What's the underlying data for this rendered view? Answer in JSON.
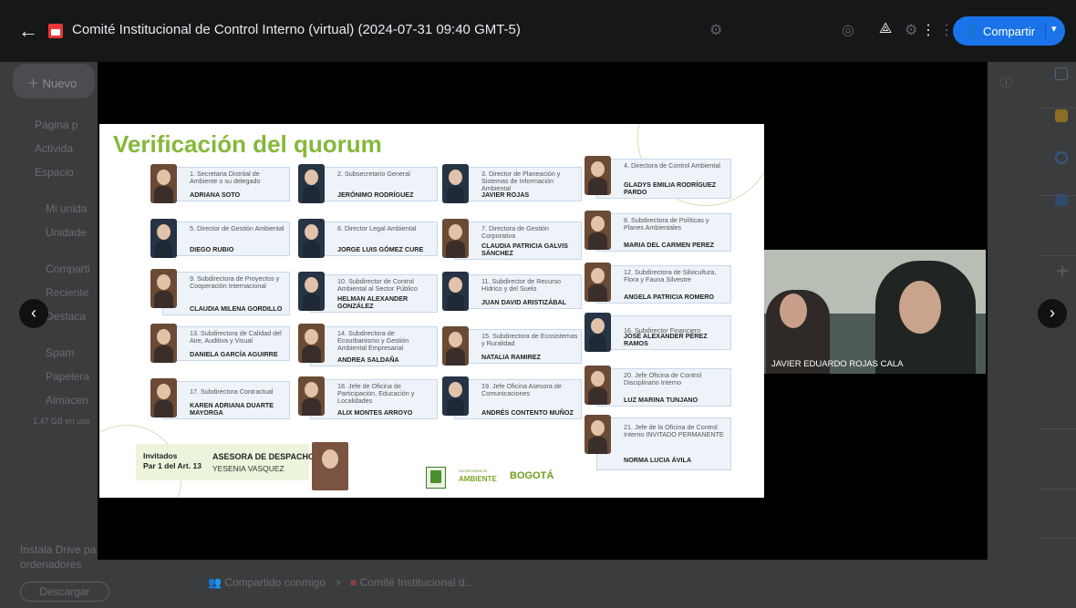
{
  "header": {
    "title": "Comité Institucional de Control Interno (virtual) (2024-07-31 09:40 GMT-5)",
    "share_label": "Compartir",
    "back_glyph": "←"
  },
  "drive": {
    "new_label": "Nuevo",
    "nav": [
      "Página p",
      "Activida",
      "Espacio",
      "Mi unida",
      "Unidade",
      "Comparti",
      "Reciente",
      "Destaca",
      "Spam",
      "Papelera",
      "Almacen"
    ],
    "storage": "1,47 GB en uso",
    "promo_line1": "Instala Drive pa",
    "promo_line2": "ordenadores",
    "download_label": "Descargar",
    "crumb_root": "Compartido conmigo",
    "crumb_sep": ">",
    "crumb_folder": "Comité Institucional d..."
  },
  "slide": {
    "title": "Verificación del quorum",
    "members": [
      {
        "role": "1. Secretaria Distrital de Ambiente o su delegado",
        "name": "ADRIANA SOTO"
      },
      {
        "role": "2. Subsecretario General",
        "name": "JERÓNIMO RODRÍGUEZ"
      },
      {
        "role": "3. Director de Planeación y Sistemas de Información Ambiental",
        "name": "JAVIER ROJAS"
      },
      {
        "role": "4. Directora de Control Ambiental",
        "name": "GLADYS EMILIA RODRÍGUEZ PARDO"
      },
      {
        "role": "5. Director de Gestión Ambiental",
        "name": "DIEGO RUBIO"
      },
      {
        "role": "6. Director Legal Ambiental",
        "name": "JORGE LUIS GÓMEZ CURE"
      },
      {
        "role": "7. Directora de Gestión Corporativa",
        "name": "CLAUDIA PATRICIA GALVIS SÁNCHEZ"
      },
      {
        "role": "8. Subdirectora de Políticas y Planes Ambientales",
        "name": "MARIA DEL CARMEN PEREZ"
      },
      {
        "role": "9. Subdirectora de Proyectos y Cooperación Internacional",
        "name": "CLAUDIA MILENA GORDILLO"
      },
      {
        "role": "10. Subdirector de Control Ambiental al Sector Público",
        "name": "HELMAN ALEXANDER GONZÁLEZ"
      },
      {
        "role": "11. Subdirector de Recurso Hídrico y del Suelo",
        "name": "JUAN DAVID ARISTIZÁBAL"
      },
      {
        "role": "12. Subdirectora de Silvicultura, Flora y Fauna Silvestre",
        "name": "ANGELA PATRICIA ROMERO"
      },
      {
        "role": "13. Subdirectora de Calidad del Aire, Auditiva y Visual",
        "name": "DANIELA GARCÍA AGUIRRE"
      },
      {
        "role": "14. Subdirectora de Ecourbanismo y Gestión Ambiental Empresarial",
        "name": "ANDREA SALDAÑA"
      },
      {
        "role": "15. Subdirectora de Ecosistemas y Ruralidad",
        "name": "NATALIA RAMIREZ"
      },
      {
        "role": "16. Subdirector Financiero",
        "name": "JOSÉ ALEXANDER PÉREZ RAMOS"
      },
      {
        "role": "17. Subdirectora Contractual",
        "name": "KAREN ADRIANA DUARTE MAYORGA"
      },
      {
        "role": "18. Jefe de Oficina de Participación, Educación y Localidades",
        "name": "ALIX MONTES ARROYO"
      },
      {
        "role": "19. Jefe Oficina Asesora de Comunicaciones",
        "name": "ANDRÉS CONTENTO MUÑOZ"
      },
      {
        "role": "20. Jefe Oficina de Control Disciplinario Interno",
        "name": "LUZ MARINA TUNJANO"
      },
      {
        "role": "21. Jefe de la Oficina de Control Interno INVITADO PERMANENTE",
        "name": "NORMA LUCIA ÁVILA"
      }
    ],
    "guests_title_1": "Invitados",
    "guests_title_2": "Par 1 del Art. 13",
    "advisor_role": "ASESORA DE DESPACHO",
    "advisor_name": "YESENIA VASQUEZ",
    "logo_secretaria_1": "SECRETARÍA DE",
    "logo_secretaria_2": "AMBIENTE",
    "logo_bogota": "BOGOTÁ"
  },
  "video": {
    "participant_name": "JAVIER EDUARDO ROJAS CALA"
  },
  "icons": {
    "prev": "chevron-left-icon",
    "next": "chevron-right-icon"
  },
  "colors": {
    "accent": "#1a73e8",
    "title_green": "#86b83a",
    "card_bg": "#eef3f9",
    "card_border": "#c6d7ea"
  }
}
